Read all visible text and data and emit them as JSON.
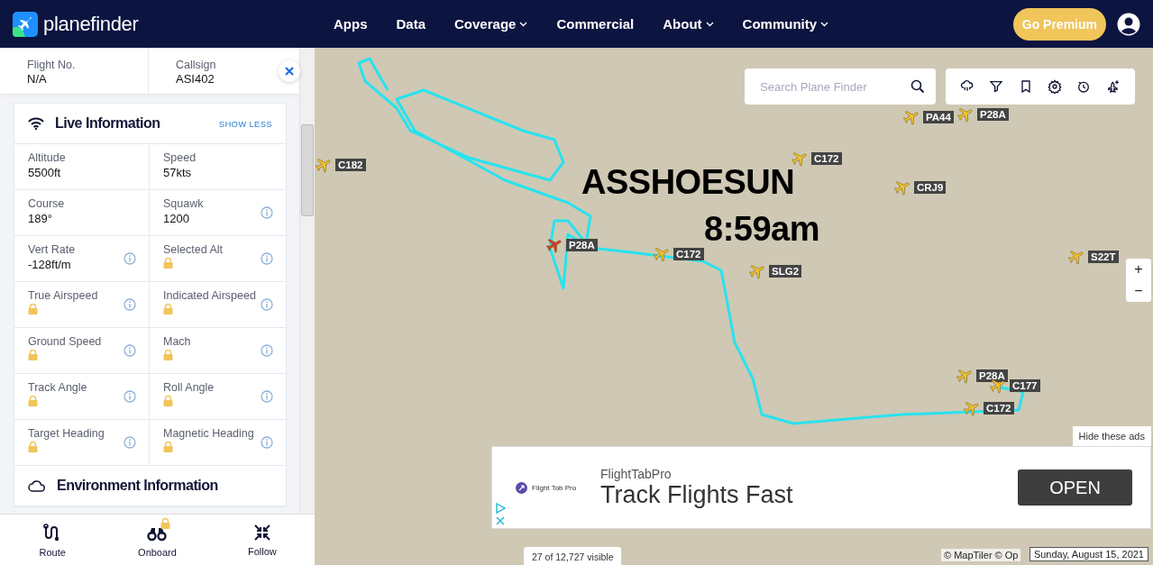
{
  "header": {
    "logo": "**plane**finder",
    "nav": [
      {
        "label": "Apps",
        "dropdown": false
      },
      {
        "label": "Data",
        "dropdown": false
      },
      {
        "label": "Coverage",
        "dropdown": true
      },
      {
        "label": "Commercial",
        "dropdown": false
      },
      {
        "label": "About",
        "dropdown": true
      },
      {
        "label": "Community",
        "dropdown": true
      }
    ],
    "premium_button": "Go Premium"
  },
  "sidebar": {
    "flight_info": [
      {
        "label": "Flight No.",
        "value": "N/A"
      },
      {
        "label": "Callsign",
        "value": "ASI402"
      }
    ],
    "live": {
      "title": "Live Information",
      "toggle": "SHOW LESS",
      "fields": [
        {
          "label": "Altitude",
          "value": "5500ft",
          "locked": false,
          "info": false
        },
        {
          "label": "Speed",
          "value": "57kts",
          "locked": false,
          "info": false
        },
        {
          "label": "Course",
          "value": "189°",
          "locked": false,
          "info": false
        },
        {
          "label": "Squawk",
          "value": "1200",
          "locked": false,
          "info": true
        },
        {
          "label": "Vert Rate",
          "value": "-128ft/m",
          "locked": false,
          "info": true
        },
        {
          "label": "Selected Alt",
          "locked": true,
          "info": true
        },
        {
          "label": "True Airspeed",
          "locked": true,
          "info": true
        },
        {
          "label": "Indicated Airspeed",
          "locked": true,
          "info": true
        },
        {
          "label": "Ground Speed",
          "locked": true,
          "info": true
        },
        {
          "label": "Mach",
          "locked": true,
          "info": true
        },
        {
          "label": "Track Angle",
          "locked": true,
          "info": true
        },
        {
          "label": "Roll Angle",
          "locked": true,
          "info": true
        },
        {
          "label": "Target Heading",
          "locked": true,
          "info": true
        },
        {
          "label": "Magnetic Heading",
          "locked": true,
          "info": true
        }
      ]
    },
    "environment": {
      "title": "Environment Information"
    },
    "bottom_tabs": [
      {
        "label": "Route",
        "locked": false
      },
      {
        "label": "Onboard",
        "locked": true
      },
      {
        "label": "Follow",
        "locked": false
      }
    ]
  },
  "map": {
    "search": {
      "placeholder": "Search Plane Finder"
    },
    "aircraft": [
      {
        "label": "C182",
        "selected": false
      },
      {
        "label": "PA44",
        "selected": false
      },
      {
        "label": "P28A",
        "selected": false
      },
      {
        "label": "C172",
        "selected": false
      },
      {
        "label": "CRJ9",
        "selected": false
      },
      {
        "label": "S22T",
        "selected": false
      },
      {
        "label": "P28A",
        "selected": true
      },
      {
        "label": "C172",
        "selected": false
      },
      {
        "label": "SLG2",
        "selected": false
      },
      {
        "label": "P28A",
        "selected": false
      },
      {
        "label": "C177",
        "selected": false
      },
      {
        "label": "C172",
        "selected": false
      }
    ],
    "annotation": [
      "ASSHOESUN",
      "8:59am"
    ],
    "zoom": [
      "+",
      "−"
    ],
    "ad": {
      "hide": "Hide these ads",
      "logo_text": "Flight Tob Pro",
      "advertiser": "FlightTabPro",
      "headline": "Track Flights Fast",
      "button": "OPEN"
    },
    "visible_count": "27 of 12,727 visible",
    "attribution": "© MapTiler © Op",
    "date": "Sunday, August 15, 2021"
  }
}
